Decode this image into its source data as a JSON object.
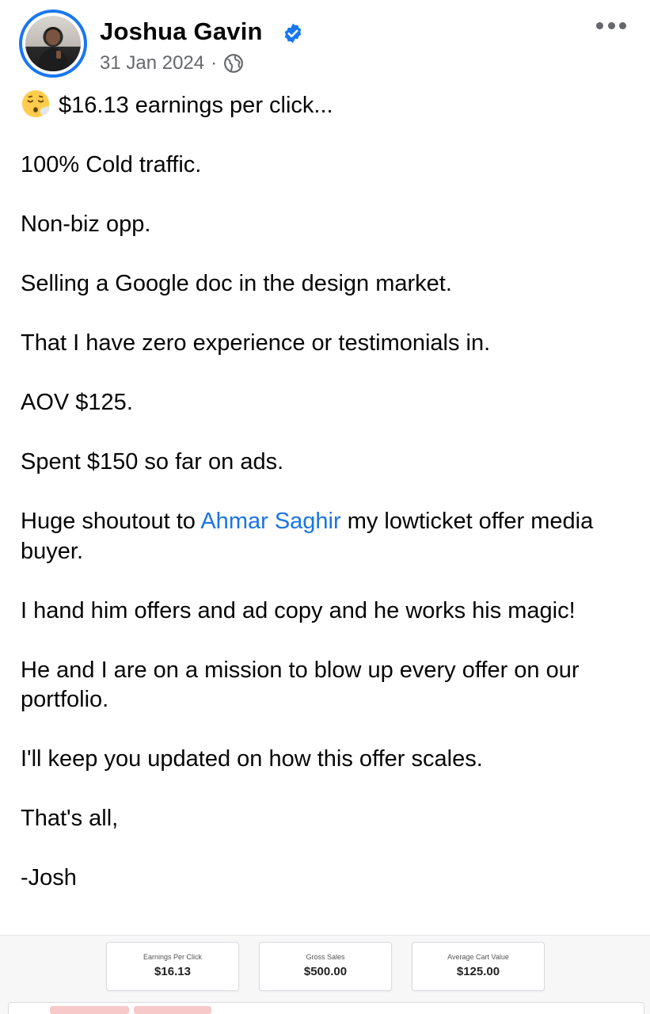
{
  "post": {
    "author": "Joshua Gavin",
    "date": "31 Jan 2024",
    "separator": "·",
    "icons": {
      "verified": "verified-badge-icon",
      "audience": "globe-icon",
      "menu": "more-options-icon",
      "emoji": "face-exhaling-emoji"
    },
    "verified_color": "#1877f2",
    "body": {
      "line_1": "$16.13 earnings per click...",
      "line_2": "100% Cold traffic.",
      "line_3": "Non-biz opp.",
      "line_4": "Selling a Google doc in the design market.",
      "line_5": "That I have zero experience or testimonials in.",
      "line_6": "AOV $125.",
      "line_7": "Spent $150 so far on ads.",
      "line_8_before": "Huge shoutout to ",
      "line_8_mention": "Ahmar Saghir",
      "line_8_after": " my lowticket offer media buyer.",
      "line_9": "I hand him offers and ad copy and he works his magic!",
      "line_10": "He and I are on a mission to blow up every offer on our portfolio.",
      "line_11": "I'll keep you updated on how this offer scales.",
      "line_12": "That's all,",
      "line_13": "-Josh"
    },
    "mention_color": "#1b74e4"
  },
  "attachment": {
    "stats": [
      {
        "label": "Earnings Per Click",
        "value": "$16.13"
      },
      {
        "label": "Gross Sales",
        "value": "$500.00"
      },
      {
        "label": "Average Cart Value",
        "value": "$125.00"
      }
    ]
  }
}
